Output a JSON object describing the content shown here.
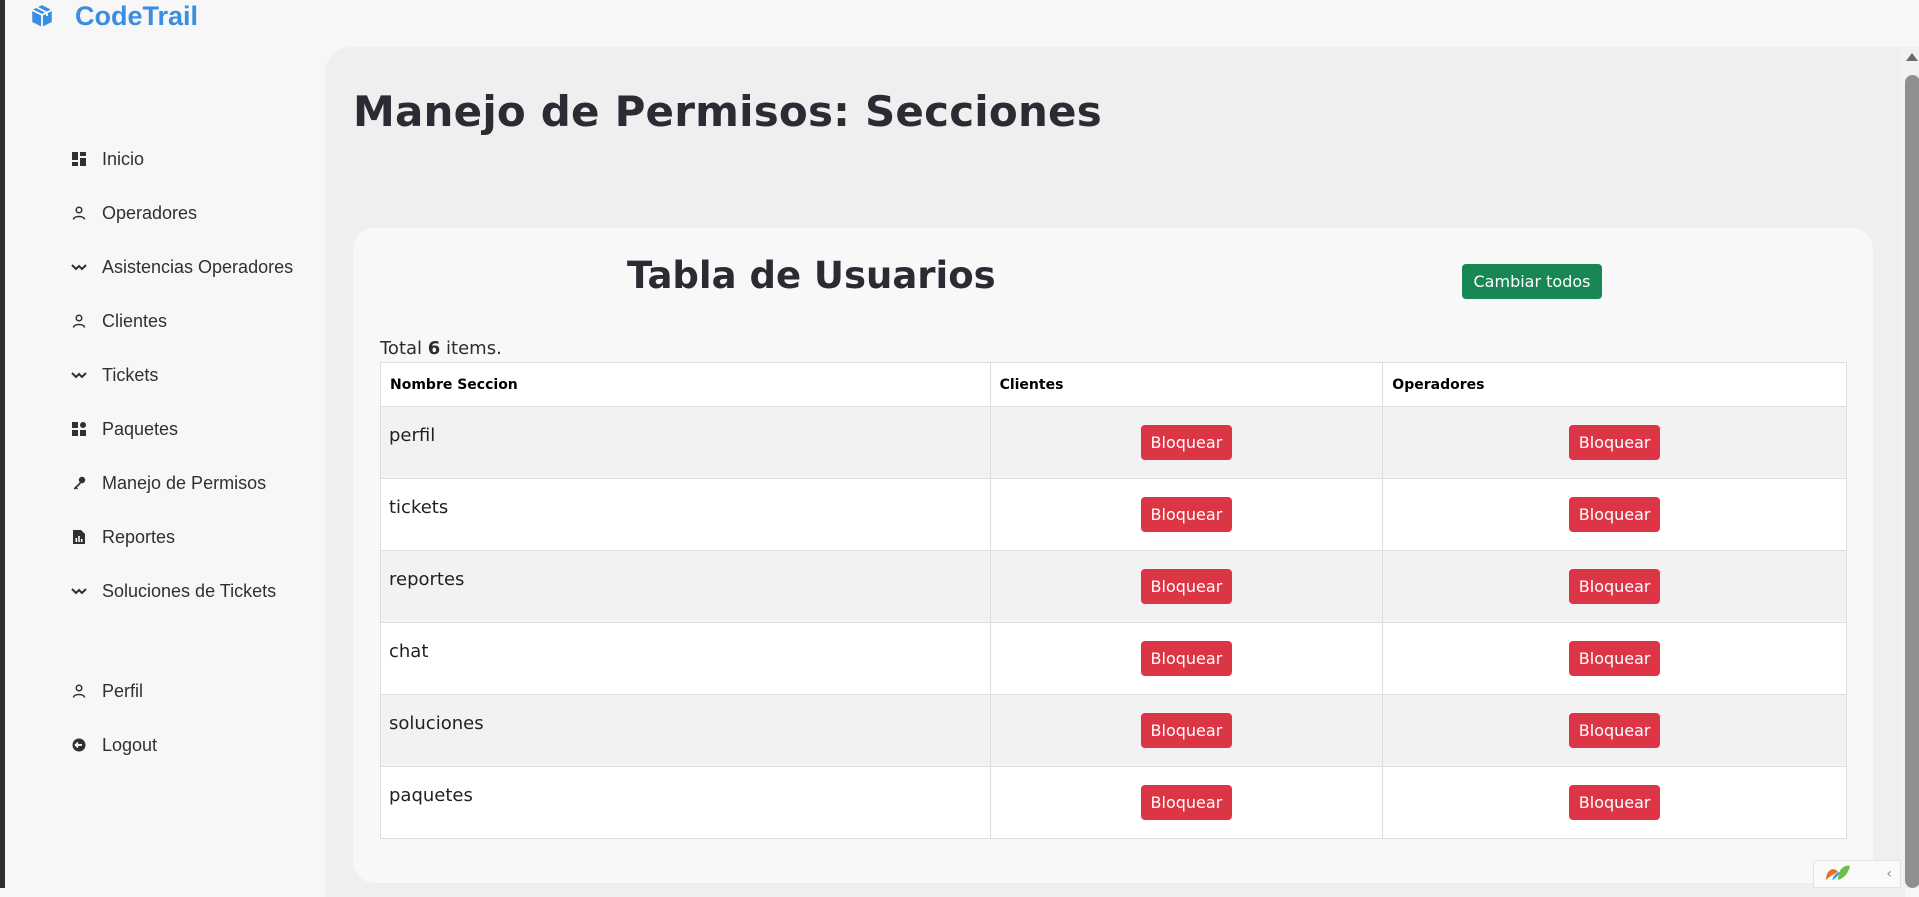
{
  "brand": {
    "name": "CodeTrail"
  },
  "sidebar": {
    "items": [
      {
        "label": "Inicio",
        "icon": "dashboard-icon"
      },
      {
        "label": "Operadores",
        "icon": "user-icon"
      },
      {
        "label": "Asistencias Operadores",
        "icon": "trend-icon"
      },
      {
        "label": "Clientes",
        "icon": "user-icon"
      },
      {
        "label": "Tickets",
        "icon": "trend-icon"
      },
      {
        "label": "Paquetes",
        "icon": "widgets-icon"
      },
      {
        "label": "Manejo de Permisos",
        "icon": "key-icon"
      },
      {
        "label": "Reportes",
        "icon": "report-icon"
      },
      {
        "label": "Soluciones de Tickets",
        "icon": "trend-icon"
      }
    ],
    "bottom_items": [
      {
        "label": "Perfil",
        "icon": "user-icon"
      },
      {
        "label": "Logout",
        "icon": "logout-icon"
      }
    ]
  },
  "main": {
    "title": "Manejo de Permisos: Secciones",
    "card": {
      "title": "Tabla de Usuarios",
      "change_all_label": "Cambiar todos",
      "summary": {
        "prefix": "Total",
        "count": "6",
        "suffix": "items."
      },
      "table": {
        "columns": [
          "Nombre Seccion",
          "Clientes",
          "Operadores"
        ],
        "rows": [
          {
            "name": "perfil",
            "clientes": "Bloquear",
            "operadores": "Bloquear"
          },
          {
            "name": "tickets",
            "clientes": "Bloquear",
            "operadores": "Bloquear"
          },
          {
            "name": "reportes",
            "clientes": "Bloquear",
            "operadores": "Bloquear"
          },
          {
            "name": "chat",
            "clientes": "Bloquear",
            "operadores": "Bloquear"
          },
          {
            "name": "soluciones",
            "clientes": "Bloquear",
            "operadores": "Bloquear"
          },
          {
            "name": "paquetes",
            "clientes": "Bloquear",
            "operadores": "Bloquear"
          }
        ]
      }
    }
  },
  "colors": {
    "brand": "#3a8de0",
    "success": "#198754",
    "danger": "#dc3545"
  }
}
